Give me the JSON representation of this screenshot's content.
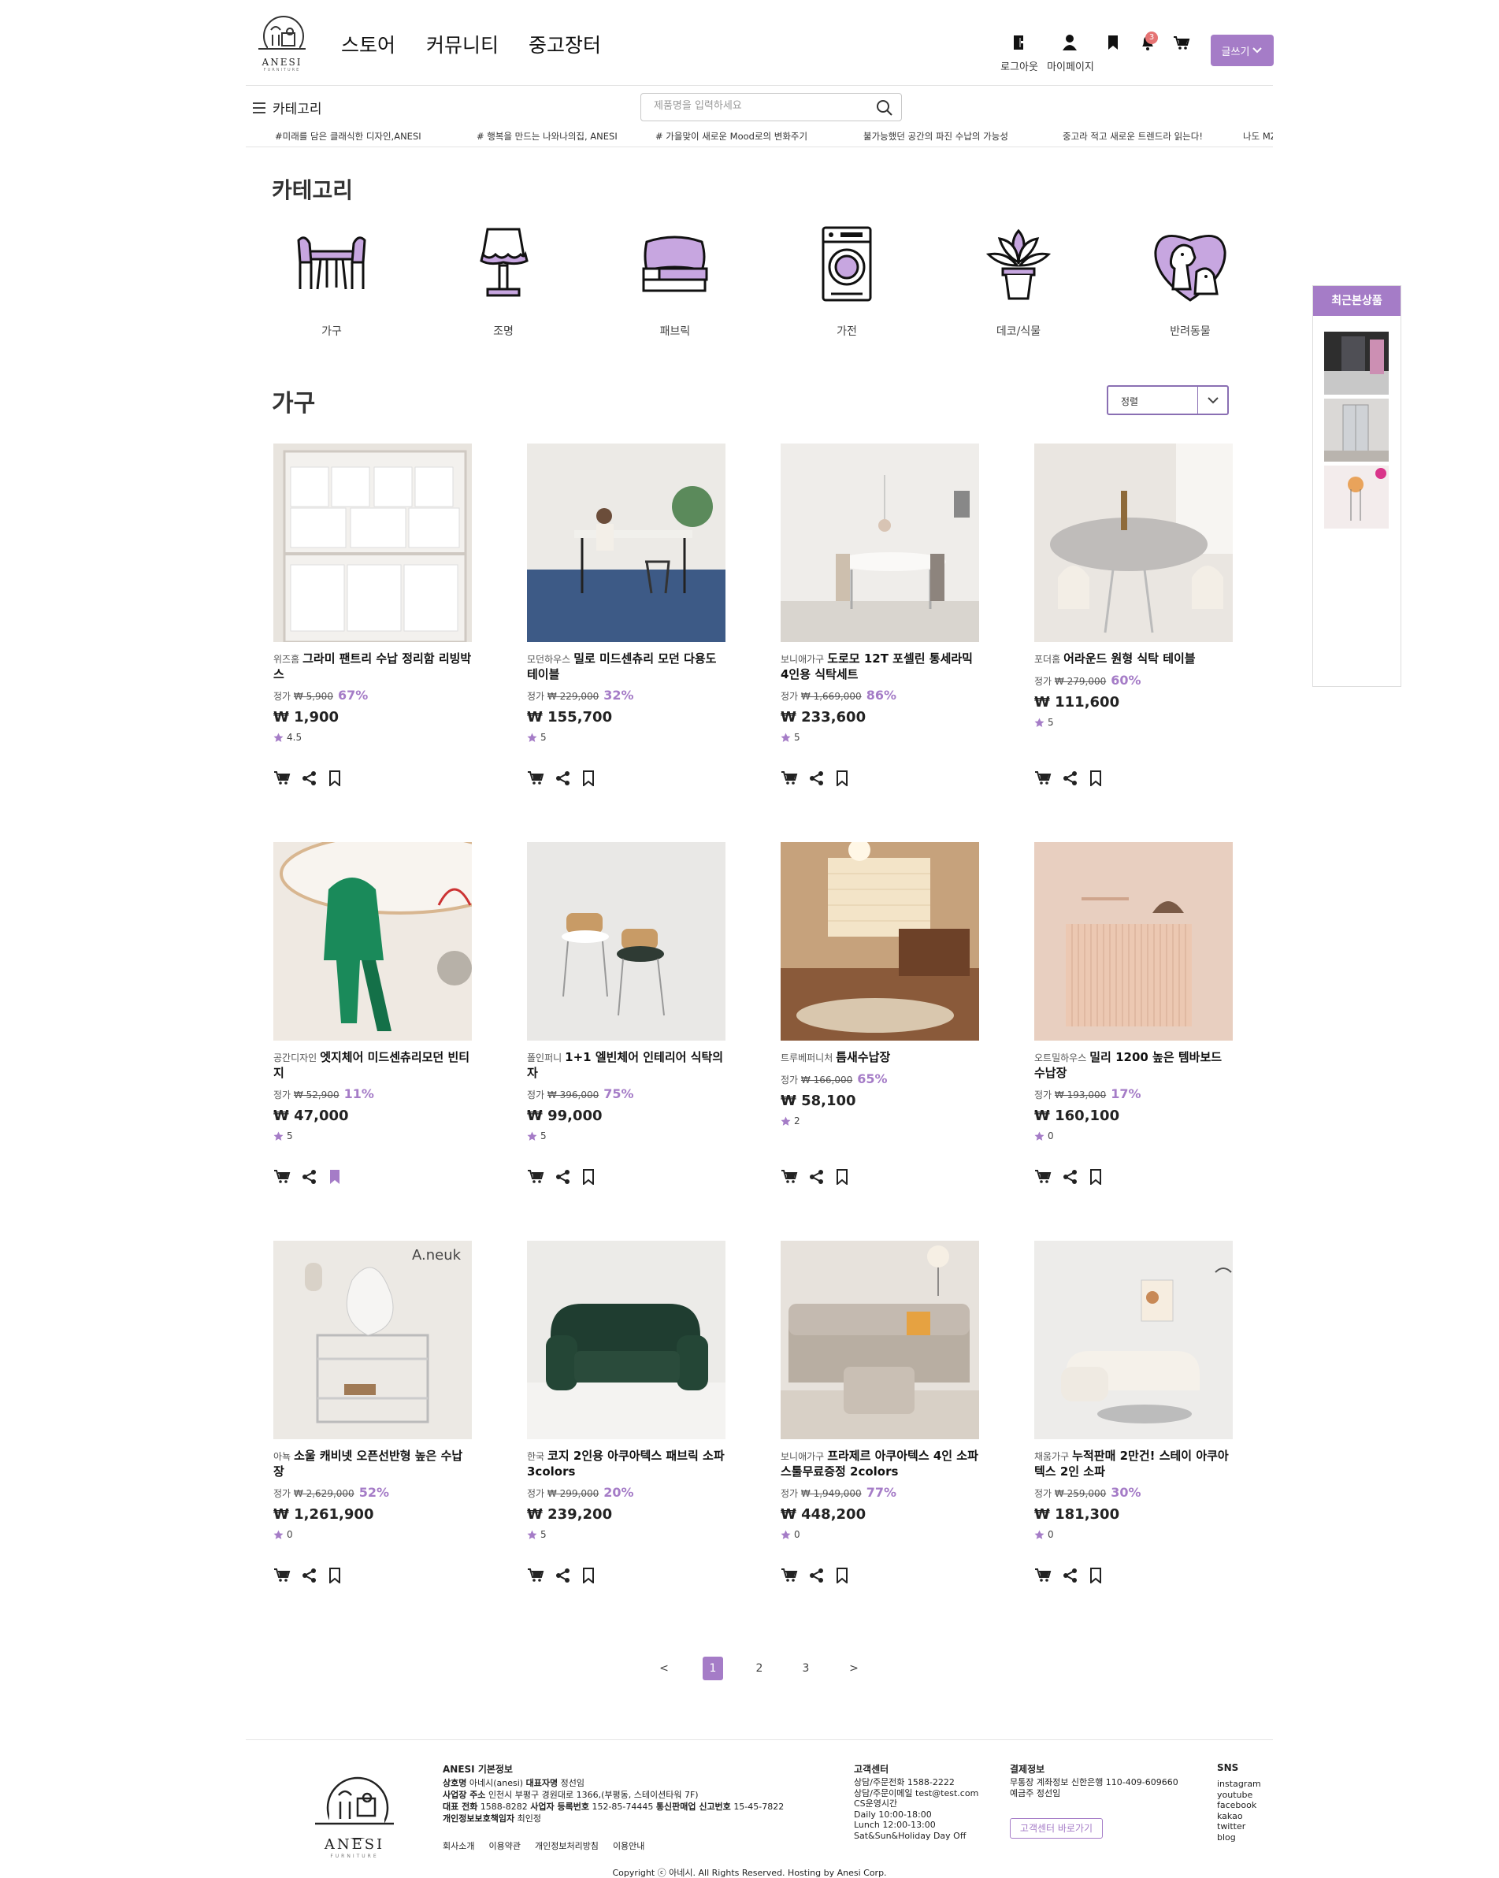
{
  "header": {
    "logo_text": "ANESI",
    "logo_sub": "FURNITURE",
    "nav": [
      "스토어",
      "커뮤니티",
      "중고장터"
    ],
    "icons": [
      {
        "name": "logout-icon",
        "label": "로그아웃"
      },
      {
        "name": "user-icon",
        "label": "마이페이지"
      },
      {
        "name": "bookmark-icon",
        "label": ""
      },
      {
        "name": "bell-icon",
        "label": ""
      },
      {
        "name": "cart-icon",
        "label": ""
      }
    ],
    "notification_count": "3",
    "write_label": "글쓰기"
  },
  "toolbar": {
    "category_label": "카테고리",
    "search_placeholder": "제품명을 입력하세요"
  },
  "marquee": [
    "#미래를 담은 클래식한 디자인,ANESI",
    "# 행복을 만드는 나와나의집, ANESI",
    "# 가을맞이 새로운 Mood로의 변화주기",
    "불가능했던 공간의 파진 수납의 가능성",
    "중고라 적고 새로운 트렌드라 읽는다!",
    "나도 MZ"
  ],
  "categories": {
    "title": "카테고리",
    "items": [
      "가구",
      "조명",
      "패브릭",
      "가전",
      "데코/식물",
      "반려동물"
    ]
  },
  "section": {
    "title": "가구",
    "sort_label": "정렬"
  },
  "products": [
    {
      "brand": "위즈홈",
      "name": "그라미 팬트리 수납 정리함 리빙박스",
      "price_label": "정가",
      "orig": "₩ 5,900",
      "disc": "67%",
      "price": "₩ 1,900",
      "rating": "4.5",
      "bookmarked": false
    },
    {
      "brand": "모던하우스",
      "name": "밀로 미드센츄리 모던 다용도 테이블",
      "price_label": "정가",
      "orig": "₩ 229,000",
      "disc": "32%",
      "price": "₩ 155,700",
      "rating": "5",
      "bookmarked": false
    },
    {
      "brand": "보니애가구",
      "name": "도로모 12T 포셀린 통세라믹 4인용 식탁세트",
      "price_label": "정가",
      "orig": "₩ 1,669,000",
      "disc": "86%",
      "price": "₩ 233,600",
      "rating": "5",
      "bookmarked": false
    },
    {
      "brand": "포더홈",
      "name": "어라운드 원형 식탁 테이블",
      "price_label": "정가",
      "orig": "₩ 279,000",
      "disc": "60%",
      "price": "₩ 111,600",
      "rating": "5",
      "bookmarked": false
    },
    {
      "brand": "공간디자인",
      "name": "엣지체어 미드센츄리모던 빈티지",
      "price_label": "정가",
      "orig": "₩ 52,900",
      "disc": "11%",
      "price": "₩ 47,000",
      "rating": "5",
      "bookmarked": true
    },
    {
      "brand": "폴인퍼니",
      "name": "1+1 엘빈체어 인테리어 식탁의자",
      "price_label": "정가",
      "orig": "₩ 396,000",
      "disc": "75%",
      "price": "₩ 99,000",
      "rating": "5",
      "bookmarked": false
    },
    {
      "brand": "트루베퍼니처",
      "name": "틈새수납장",
      "price_label": "정가",
      "orig": "₩ 166,000",
      "disc": "65%",
      "price": "₩ 58,100",
      "rating": "2",
      "bookmarked": false
    },
    {
      "brand": "오트밀하우스",
      "name": "밀리 1200 높은 템바보드 수납장",
      "price_label": "정가",
      "orig": "₩ 193,000",
      "disc": "17%",
      "price": "₩ 160,100",
      "rating": "0",
      "bookmarked": false
    },
    {
      "brand": "아뇩",
      "name": "소울 캐비넷 오픈선반형 높은 수납장",
      "price_label": "정가",
      "orig": "₩ 2,629,000",
      "disc": "52%",
      "price": "₩ 1,261,900",
      "rating": "0",
      "bookmarked": false,
      "photo_text": "A.neuk"
    },
    {
      "brand": "한국",
      "name": "코지 2인용 아쿠아텍스 패브릭 소파 3colors",
      "price_label": "정가",
      "orig": "₩ 299,000",
      "disc": "20%",
      "price": "₩ 239,200",
      "rating": "5",
      "bookmarked": false
    },
    {
      "brand": "보니애가구",
      "name": "프라제르 아쿠아텍스 4인 소파 스툴무료증정 2colors",
      "price_label": "정가",
      "orig": "₩ 1,949,000",
      "disc": "77%",
      "price": "₩ 448,200",
      "rating": "0",
      "bookmarked": false
    },
    {
      "brand": "채움가구",
      "name": "누적판매 2만건! 스테이 아쿠아텍스 2인 소파",
      "price_label": "정가",
      "orig": "₩ 259,000",
      "disc": "30%",
      "price": "₩ 181,300",
      "rating": "0",
      "bookmarked": false
    }
  ],
  "recent": {
    "title": "최근본상품"
  },
  "pagination": {
    "prev": "<",
    "pages": [
      "1",
      "2",
      "3"
    ],
    "current": "1",
    "next": ">"
  },
  "footer": {
    "company_title": "ANESI 기본정보",
    "rows": [
      {
        "k": "상호명",
        "v": "아네시(anesi)",
        "k2": "대표자명",
        "v2": "정선임"
      },
      {
        "k": "사업장 주소",
        "v": "인천시 부평구 경원대로 1366,(부평동, 스테이션타워 7F)",
        "k2": "",
        "v2": ""
      },
      {
        "k": "대표 전화",
        "v": "1588-8282",
        "k2": "사업자 등록번호",
        "v2": "152-85-74445",
        "k3": "통신판매업 신고번호",
        "v3": "15-45-7822"
      },
      {
        "k": "개인정보보호책임자",
        "v": "최인정",
        "k2": "",
        "v2": ""
      }
    ],
    "links": [
      "회사소개",
      "이용약관",
      "개인정보처리방침",
      "이용안내"
    ],
    "cs_title": "고객센터",
    "cs_lines": [
      "상담/주문전화 1588-2222",
      "상담/주문이메일 test@test.com",
      "CS운영시간",
      "Daily 10:00-18:00",
      "Lunch 12:00-13:00",
      "Sat&Sun&Holiday Day Off"
    ],
    "pay_title": "결제정보",
    "pay_lines": [
      "무통장 계좌정보 신한은행 110-409-609660",
      "예금주 정선임"
    ],
    "cs_button": "고객센터 바로가기",
    "sns_title": "SNS",
    "sns": [
      "instagram",
      "youtube",
      "facebook",
      "kakao",
      "twitter",
      "blog"
    ],
    "copyright": "Copyright ⓒ 아네시. All Rights Reserved. Hosting by Anesi Corp."
  },
  "colors": {
    "accent": "#a57cc7",
    "badge": "#e57373"
  }
}
